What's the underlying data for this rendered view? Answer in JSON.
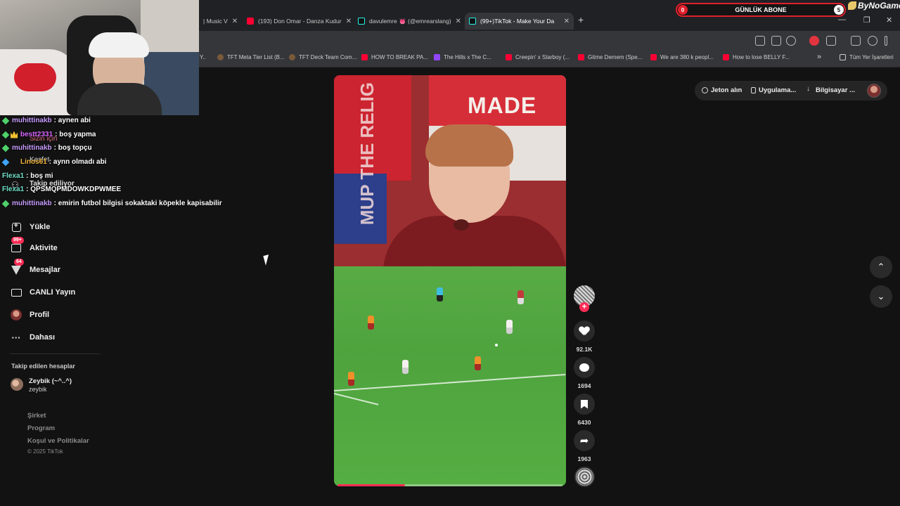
{
  "browser": {
    "tabs": [
      {
        "label": "| Music V",
        "favicon": "none",
        "active": false
      },
      {
        "label": "(193) Don Omar - Danza Kudur",
        "favicon": "youtube",
        "active": false
      },
      {
        "label": "davulemre 👅 (@emrearslang)",
        "favicon": "tiktok",
        "active": false
      },
      {
        "label": "(99+)TikTok - Make Your Da",
        "favicon": "tiktok",
        "active": true
      }
    ],
    "new_tab": "+",
    "window_controls": {
      "minimize": "—",
      "restore": "❐",
      "close": "✕"
    },
    "bookmarks": [
      {
        "label": "Y..",
        "favicon": "none"
      },
      {
        "label": "TFT Meta Tier List (B...",
        "favicon": "tft"
      },
      {
        "label": "TFT Deck Team Com...",
        "favicon": "tft"
      },
      {
        "label": "HOW TO BREAK PA...",
        "favicon": "youtube"
      },
      {
        "label": "The Hills x The C...",
        "favicon": "twitch"
      },
      {
        "label": "Creepin' x Starboy (...",
        "favicon": "youtube"
      },
      {
        "label": "Gitme Demem (Spe...",
        "favicon": "youtube"
      },
      {
        "label": "We are 380 k peopl...",
        "favicon": "youtube"
      },
      {
        "label": "How to lose BELLY F...",
        "favicon": "youtube"
      }
    ],
    "bookmarks_more": "»",
    "all_bookmarks": "Tüm Yer İşaretleri"
  },
  "overlay": {
    "sub_widget": {
      "left_value": "0",
      "title": "GÜNLÜK ABONE",
      "right_value": "5"
    },
    "brand": "ByNoGame",
    "chat": [
      {
        "icon": "gem-green",
        "user": "muhittinakb",
        "message": ": aynen abi",
        "user_color": "#c79cff"
      },
      {
        "icon": "crown",
        "user": "bestt2331",
        "message": ": boş yapma",
        "user_color": "#d966ff"
      },
      {
        "icon": "gem-green",
        "user": "muhittinakb",
        "message": ": boş topçu",
        "user_color": "#c79cff"
      },
      {
        "icon": "gem-blue",
        "user": "Linos61",
        "message": ": aynn olmadı abi",
        "user_color": "#f0b33a"
      },
      {
        "icon": "none",
        "user": "Flexa1",
        "message": ": boş mi",
        "user_color": "#6fe0c9"
      },
      {
        "icon": "none",
        "user": "Flexa1",
        "message": ": QPSMQPMDOWKDPWMEE",
        "user_color": "#6fe0c9"
      },
      {
        "icon": "gem-green",
        "user": "muhittinakb",
        "message": ": emirin futbol bilgisi sokaktaki köpekle kapisabilir",
        "user_color": "#c79cff"
      }
    ],
    "behind_labels": {
      "for_you": "Sizin için",
      "explore": "Keşfet",
      "following": "Takip ediliyor"
    }
  },
  "sidebar": {
    "items": [
      {
        "label": "Yükle",
        "icon": "upload-icon",
        "badge": ""
      },
      {
        "label": "Aktivite",
        "icon": "inbox-icon",
        "badge": "99+"
      },
      {
        "label": "Mesajlar",
        "icon": "paper-plane-icon",
        "badge": "64"
      },
      {
        "label": "CANLI Yayın",
        "icon": "live-icon",
        "badge": ""
      },
      {
        "label": "Profil",
        "icon": "avatar",
        "badge": ""
      },
      {
        "label": "Dahası",
        "icon": "more-icon",
        "badge": ""
      }
    ],
    "followed_title": "Takip edilen hesaplar",
    "followed": [
      {
        "name": "Zeybik (~^..^)",
        "handle": "zeybik"
      }
    ],
    "footer": {
      "links": [
        "Şirket",
        "Program",
        "Koşul ve Politikalar"
      ],
      "copyright": "© 2025 TikTok"
    }
  },
  "top_actions": {
    "coins": "Jeton alın",
    "app": "Uygulama...",
    "desktop": "Bilgisayar ..."
  },
  "video": {
    "banner_text": "MADE",
    "banner_vertical": "MUP THE RELIG",
    "progress": 0.3,
    "likes": "92.1K",
    "comments": "1694",
    "saves": "6430",
    "shares": "1963",
    "follow_plus": "+"
  },
  "navigation": {
    "up": "⌃",
    "down": "⌄"
  },
  "colors": {
    "accent": "#fe2c55",
    "background": "#121212",
    "sub_border": "#e0202d"
  }
}
